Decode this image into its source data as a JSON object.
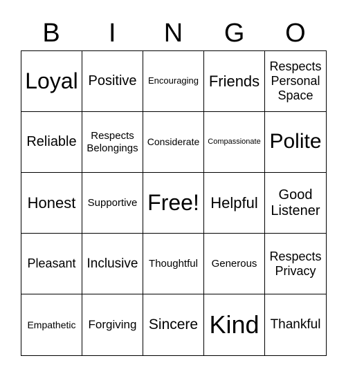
{
  "header": [
    "B",
    "I",
    "N",
    "G",
    "O"
  ],
  "cells": [
    {
      "text": "Loyal",
      "size": 32
    },
    {
      "text": "Positive",
      "size": 20
    },
    {
      "text": "Encouraging",
      "size": 13
    },
    {
      "text": "Friends",
      "size": 22
    },
    {
      "text": "Respects Personal Space",
      "size": 18
    },
    {
      "text": "Reliable",
      "size": 20
    },
    {
      "text": "Respects Belongings",
      "size": 15
    },
    {
      "text": "Considerate",
      "size": 14
    },
    {
      "text": "Compassionate",
      "size": 11
    },
    {
      "text": "Polite",
      "size": 30
    },
    {
      "text": "Honest",
      "size": 22
    },
    {
      "text": "Supportive",
      "size": 15
    },
    {
      "text": "Free!",
      "size": 32
    },
    {
      "text": "Helpful",
      "size": 22
    },
    {
      "text": "Good Listener",
      "size": 20
    },
    {
      "text": "Pleasant",
      "size": 18
    },
    {
      "text": "Inclusive",
      "size": 19
    },
    {
      "text": "Thoughtful",
      "size": 15
    },
    {
      "text": "Generous",
      "size": 15
    },
    {
      "text": "Respects Privacy",
      "size": 18
    },
    {
      "text": "Empathetic",
      "size": 14
    },
    {
      "text": "Forgiving",
      "size": 17
    },
    {
      "text": "Sincere",
      "size": 21
    },
    {
      "text": "Kind",
      "size": 36
    },
    {
      "text": "Thankful",
      "size": 19
    }
  ]
}
